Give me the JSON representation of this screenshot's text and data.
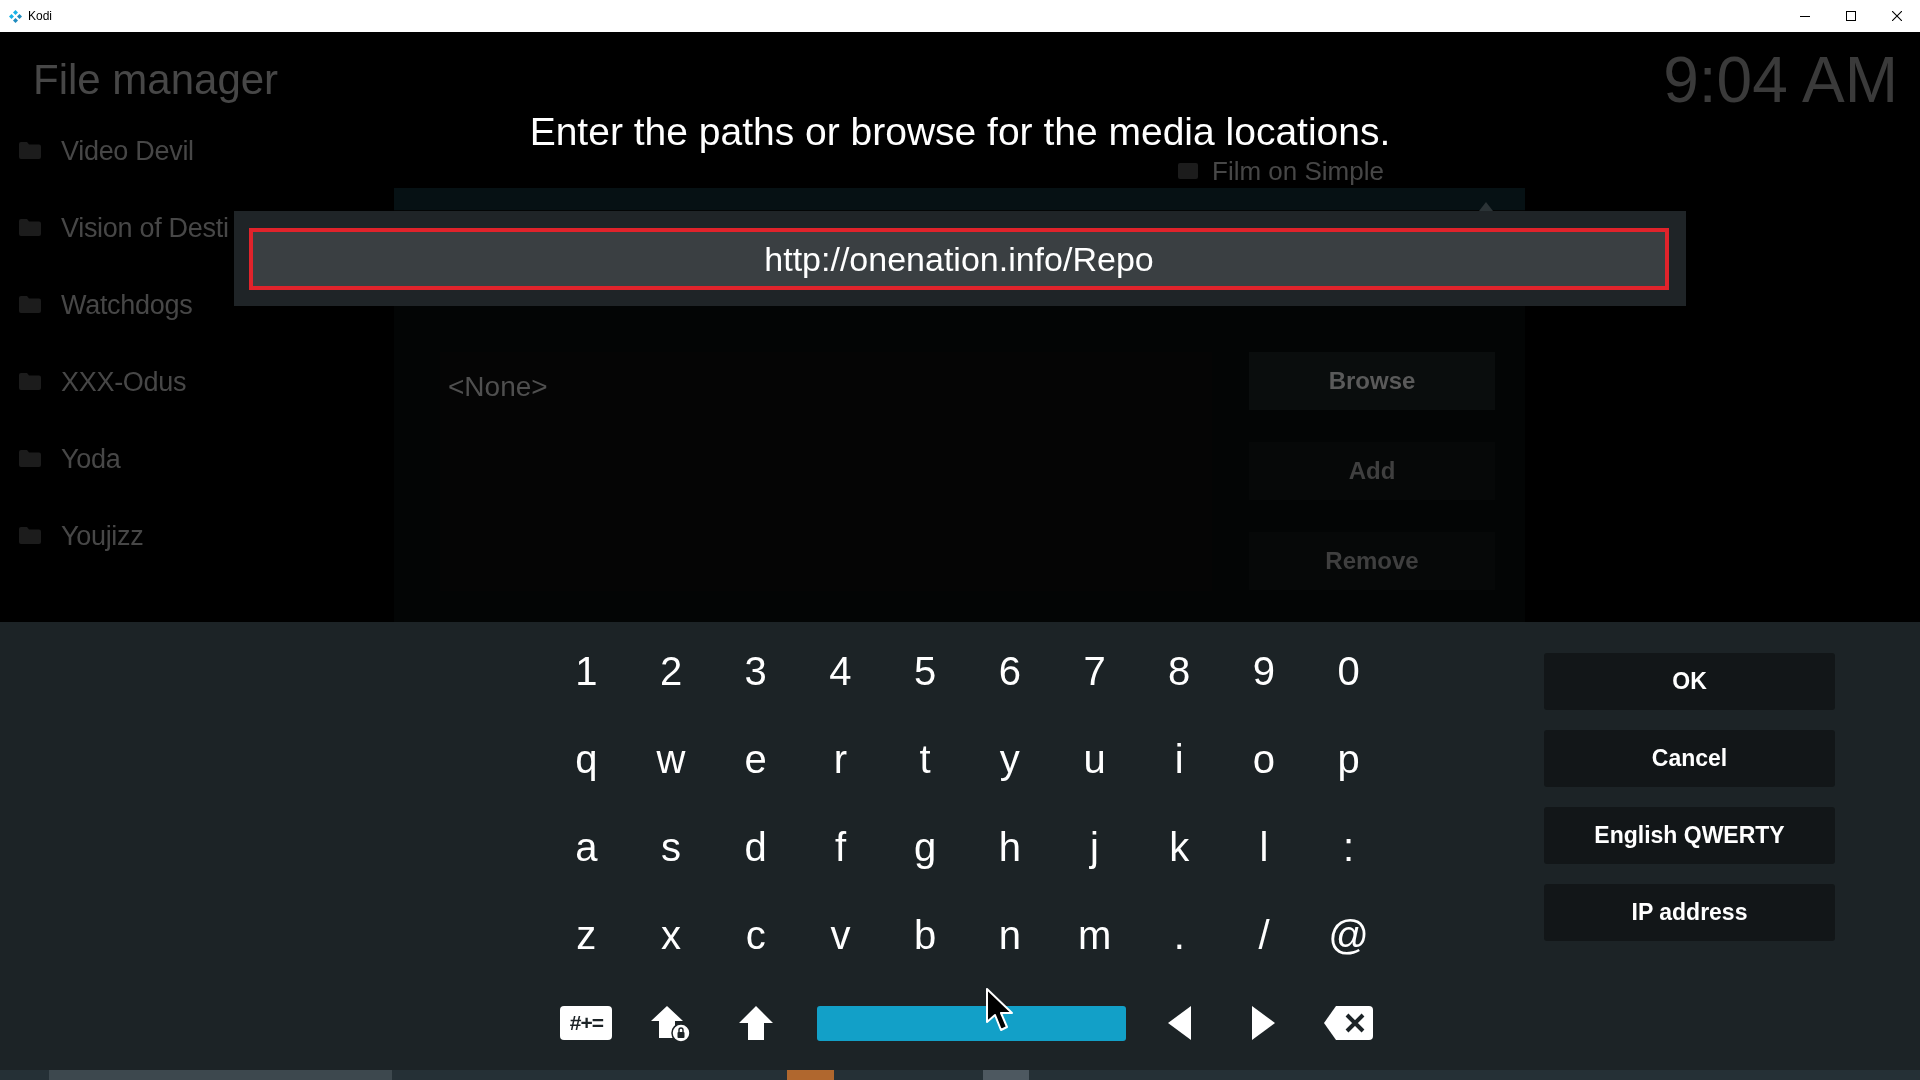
{
  "window": {
    "title": "Kodi"
  },
  "file_manager": {
    "title": "File manager",
    "clock": "9:04 AM",
    "sources": [
      {
        "label": "Video Devil"
      },
      {
        "label": "Vision of Desti"
      },
      {
        "label": "Watchdogs"
      },
      {
        "label": "XXX-Odus"
      },
      {
        "label": "Yoda"
      },
      {
        "label": "Youjizz"
      }
    ]
  },
  "source_dialog": {
    "title": "Film on Simple",
    "paths": [
      "<None>"
    ],
    "buttons": [
      {
        "label": "Browse",
        "disabled": false
      },
      {
        "label": "Add",
        "disabled": true
      },
      {
        "label": "Remove",
        "disabled": true
      }
    ]
  },
  "keyboard": {
    "heading": "Enter the paths or browse for the media locations.",
    "input": {
      "value": "http://onenation.info/Repo"
    },
    "rows": [
      [
        {
          "label": "1",
          "selected": false
        },
        {
          "label": "2",
          "selected": false
        },
        {
          "label": "3",
          "selected": false
        },
        {
          "label": "4",
          "selected": false
        },
        {
          "label": "5",
          "selected": false
        },
        {
          "label": "6",
          "selected": false
        },
        {
          "label": "7",
          "selected": false
        },
        {
          "label": "8",
          "selected": false
        },
        {
          "label": "9",
          "selected": false
        },
        {
          "label": "0",
          "selected": false
        }
      ],
      [
        {
          "label": "q",
          "selected": false
        },
        {
          "label": "w",
          "selected": false
        },
        {
          "label": "e",
          "selected": false
        },
        {
          "label": "r",
          "selected": false
        },
        {
          "label": "t",
          "selected": false
        },
        {
          "label": "y",
          "selected": false
        },
        {
          "label": "u",
          "selected": false
        },
        {
          "label": "i",
          "selected": false
        },
        {
          "label": "o",
          "selected": false
        },
        {
          "label": "p",
          "selected": false
        }
      ],
      [
        {
          "label": "a",
          "selected": false
        },
        {
          "label": "s",
          "selected": false
        },
        {
          "label": "d",
          "selected": false
        },
        {
          "label": "f",
          "selected": false
        },
        {
          "label": "g",
          "selected": false
        },
        {
          "label": "h",
          "selected": false
        },
        {
          "label": "j",
          "selected": false
        },
        {
          "label": "k",
          "selected": false
        },
        {
          "label": "l",
          "selected": false
        },
        {
          "label": ":",
          "selected": false
        }
      ],
      [
        {
          "label": "z",
          "selected": false
        },
        {
          "label": "x",
          "selected": false
        },
        {
          "label": "c",
          "selected": false
        },
        {
          "label": "v",
          "selected": false
        },
        {
          "label": "b",
          "selected": false
        },
        {
          "label": "n",
          "selected": false
        },
        {
          "label": "m",
          "selected": false
        },
        {
          "label": ".",
          "selected": false
        },
        {
          "label": "/",
          "selected": false
        },
        {
          "label": "@",
          "selected": false
        }
      ]
    ],
    "controls": [
      {
        "kind": "symbols",
        "label": "#+=",
        "selected": false
      },
      {
        "kind": "caps_lock",
        "selected": false
      },
      {
        "kind": "shift",
        "selected": false
      },
      {
        "kind": "space",
        "selected": true
      },
      {
        "kind": "left",
        "selected": false
      },
      {
        "kind": "right",
        "selected": false
      },
      {
        "kind": "backspace",
        "selected": false
      }
    ],
    "buttons": [
      {
        "label": "OK",
        "selected": false
      },
      {
        "label": "Cancel",
        "selected": false
      },
      {
        "label": "English QWERTY",
        "selected": false
      },
      {
        "label": "IP address",
        "selected": false
      }
    ]
  }
}
